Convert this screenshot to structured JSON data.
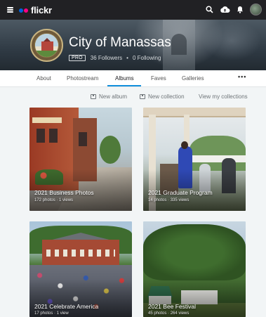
{
  "app": {
    "logo_text": "flickr",
    "brand_colors": {
      "blue": "#0063dc",
      "pink": "#ff0084",
      "accent": "#128fdc"
    }
  },
  "topbar_icons": [
    "menu-icon",
    "search-icon",
    "upload-cloud-icon",
    "notification-bell-icon",
    "user-avatar"
  ],
  "profile": {
    "name": "City of Manassas",
    "pro_badge": "PRO",
    "followers": "36 Followers",
    "separator": "•",
    "following": "0 Following"
  },
  "tabs": [
    {
      "label": "About",
      "active": false
    },
    {
      "label": "Photostream",
      "active": false
    },
    {
      "label": "Albums",
      "active": true
    },
    {
      "label": "Faves",
      "active": false
    },
    {
      "label": "Galleries",
      "active": false
    }
  ],
  "more_label": "•••",
  "actions": {
    "new_album": "New album",
    "new_collection": "New collection",
    "view_collections": "View my collections"
  },
  "albums": [
    {
      "title": "2021 Business Photos",
      "stats": "172 photos · 1 views"
    },
    {
      "title": "2021 Graduate Program",
      "stats": "14 photos · 335 views"
    },
    {
      "title": "2021 Celebrate America",
      "stats": "17 photos · 1 view"
    },
    {
      "title": "2021 Bee Festival",
      "stats": "45 photos · 264 views"
    }
  ]
}
